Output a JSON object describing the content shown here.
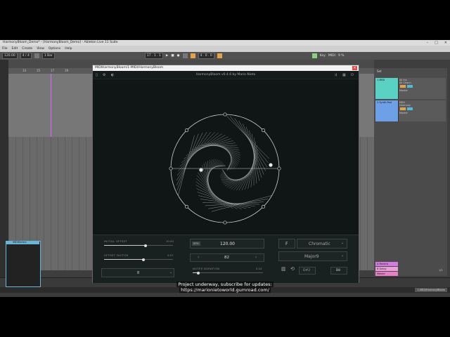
{
  "window": {
    "title": "HarmonyBloom_Demo* - [HarmonyBloom_Demo] - Ableton Live 11 Suite",
    "controls": [
      "–",
      "□",
      "✕"
    ]
  },
  "menu": [
    "File",
    "Edit",
    "Create",
    "View",
    "Options",
    "Help"
  ],
  "transport": {
    "tempo": "120.00",
    "time_sig": "4 / 4",
    "metro": "1 Bar",
    "position": "17 . 1 . 1",
    "loop_len": "4 . 0 . 0",
    "key_label": "Key",
    "midi_label": "MIDI",
    "cpu": "9 %"
  },
  "ruler": [
    "13",
    "15",
    "17",
    "19",
    "21",
    "23",
    "25",
    "27",
    "29",
    "31",
    "33",
    "35",
    "37",
    "39"
  ],
  "mixer": {
    "header": "Set",
    "tracks": [
      {
        "name": "1 MIDI",
        "color": "#5ad1c3",
        "in": "All Ins",
        "ch": "All Chann",
        "monitor": "Master"
      },
      {
        "name": "2 Synth Pad",
        "color": "#6ea0e8",
        "in": "MIDI",
        "ch": "Harmony",
        "monitor": "Master"
      }
    ],
    "returns": [
      {
        "name": "A Reverb",
        "color": "#d47ae0"
      },
      {
        "name": "B Delay",
        "color": "#e8a0d8"
      },
      {
        "name": "Master",
        "color": "#e880c8"
      }
    ],
    "page": "1/2"
  },
  "device_panel": {
    "title": "MIDIHarmo"
  },
  "status": {
    "right": "1-MIDI/HarmonyBloom"
  },
  "plugin": {
    "window_title": "MIDIHarmonyBloom/1-MIDI/HarmonyBloom",
    "header_title": "HarmonyBloom v0.4.6 by Mario Nieto",
    "controls": {
      "initial_offset": {
        "label": "INITIAL OFFSET",
        "value": "10.00",
        "level": 0.6
      },
      "offset_factor": {
        "label": "OFFSET FACTOR",
        "value": "0.57",
        "level": 0.57
      },
      "mode_value": "8",
      "mode_arrow": "⌄",
      "bpm_badge": "BPM",
      "tempo": "120.00",
      "step_prev": "‹",
      "step_value": "82",
      "step_next": "›",
      "notes_duration": {
        "label": "NOTES DURATION",
        "value": "0.24",
        "level": 0.08
      },
      "key_root": "F",
      "scale": "Chromatic",
      "chord": "Major9",
      "low_note": "D#2",
      "high_note": "B8"
    }
  },
  "caption": {
    "line1": "Project underway, subscribe for updates:",
    "line2": "https://marionietoworld.gumroad.com/"
  },
  "colors": {
    "accent": "#e3a34a",
    "plugin_bg": "#101515",
    "viz_line": "#c9d4d2"
  }
}
